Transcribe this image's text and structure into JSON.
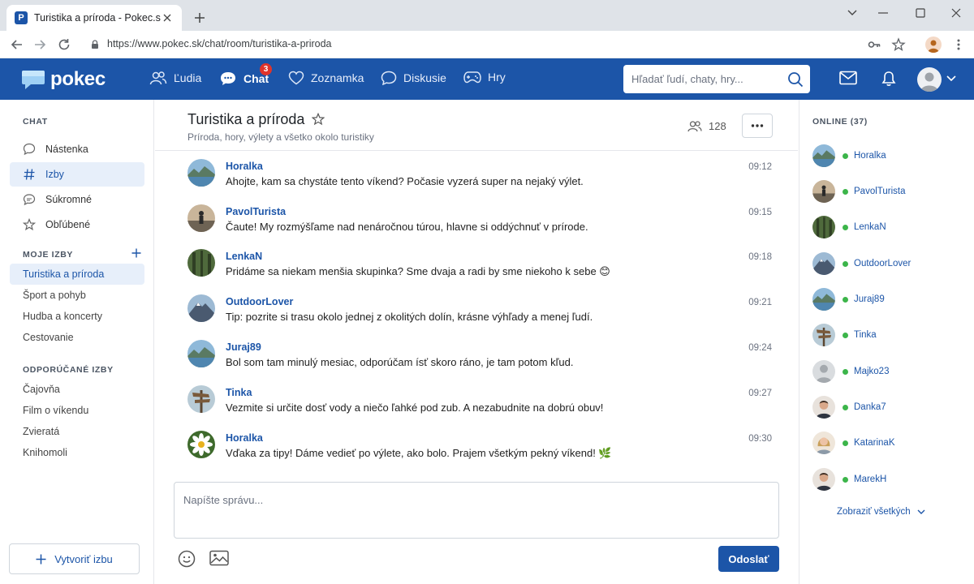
{
  "browser": {
    "tab_title": "Turistika a príroda - Pokec.sk",
    "favicon_letter": "P",
    "url": "https://www.pokec.sk/chat/room/turistika-a-priroda"
  },
  "header": {
    "logo": "pokec",
    "nav": [
      {
        "label": "Ľudia",
        "icon": "people-icon"
      },
      {
        "label": "Chat",
        "icon": "chat-icon",
        "badge": "3",
        "active": true
      },
      {
        "label": "Zoznamka",
        "icon": "heart-icon"
      },
      {
        "label": "Diskusie",
        "icon": "discussion-icon"
      },
      {
        "label": "Hry",
        "icon": "gamepad-icon"
      }
    ],
    "search_placeholder": "Hľadať ľudí, chaty, hry..."
  },
  "sidebar": {
    "chat_title": "CHAT",
    "items": [
      {
        "label": "Nástenka",
        "icon": "bubble-icon"
      },
      {
        "label": "Izby",
        "icon": "hash-icon",
        "active": true
      },
      {
        "label": "Súkromné",
        "icon": "private-chat-icon"
      },
      {
        "label": "Obľúbené",
        "icon": "star-icon"
      }
    ],
    "my_rooms_title": "MOJE IZBY",
    "my_rooms": [
      "Turistika a príroda",
      "Šport a pohyb",
      "Hudba a koncerty",
      "Cestovanie"
    ],
    "recommended_title": "ODPORÚČANÉ IZBY",
    "recommended": [
      "Čajovňa",
      "Film o víkendu",
      "Zvieratá",
      "Knihomoli"
    ],
    "create_label": "Vytvoriť izbu"
  },
  "room": {
    "title": "Turistika a príroda",
    "subtitle": "Príroda, hory, výlety a všetko okolo turistiky",
    "member_count": "128"
  },
  "messages": [
    {
      "user": "Horalka",
      "time": "09:12",
      "text": "Ahojte, kam sa chystáte tento víkend? Počasie vyzerá super na nejaký výlet.",
      "avatar": "lake-avatar"
    },
    {
      "user": "PavolTurista",
      "time": "09:15",
      "text": "Čaute! My rozmýšľame nad nenáročnou túrou, hlavne si oddýchnuť v prírode.",
      "avatar": "hiker-avatar"
    },
    {
      "user": "LenkaN",
      "time": "09:18",
      "text": "Pridáme sa niekam menšia skupinka? Sme dvaja a radi by sme niekoho k sebe 😊",
      "avatar": "forest-avatar"
    },
    {
      "user": "OutdoorLover",
      "time": "09:21",
      "text": "Tip: pozrite si trasu okolo jednej z okolitých dolín, krásne výhľady a menej ľudí.",
      "avatar": "mountain-avatar"
    },
    {
      "user": "Juraj89",
      "time": "09:24",
      "text": "Bol som tam minulý mesiac, odporúčam ísť skoro ráno, je tam potom kľud.",
      "avatar": "lake-avatar"
    },
    {
      "user": "Tinka",
      "time": "09:27",
      "text": "Vezmite si určite dosť vody a niečo ľahké pod zub. A nezabudnite na dobrú obuv!",
      "avatar": "signpost-avatar"
    },
    {
      "user": "Horalka",
      "time": "09:30",
      "text": "Vďaka za tipy! Dáme vedieť po výlete, ako bolo. Prajem všetkým pekný víkend! 🌿",
      "avatar": "daisy-avatar"
    }
  ],
  "composer": {
    "placeholder": "Napíšte správu...",
    "send_label": "Odoslať"
  },
  "online": {
    "title": "ONLINE (37)",
    "users": [
      {
        "name": "Horalka",
        "avatar": "lake-avatar"
      },
      {
        "name": "PavolTurista",
        "avatar": "hiker-avatar"
      },
      {
        "name": "LenkaN",
        "avatar": "forest-avatar"
      },
      {
        "name": "OutdoorLover",
        "avatar": "mountain-avatar"
      },
      {
        "name": "Juraj89",
        "avatar": "lake-avatar"
      },
      {
        "name": "Tinka",
        "avatar": "signpost-avatar"
      },
      {
        "name": "Majko23",
        "avatar": "default-avatar"
      },
      {
        "name": "Danka7",
        "avatar": "man-avatar"
      },
      {
        "name": "KatarinaK",
        "avatar": "woman-avatar"
      },
      {
        "name": "MarekH",
        "avatar": "man-avatar"
      }
    ],
    "show_all_label": "Zobraziť všetkých"
  },
  "colors": {
    "brand": "#1c55a8",
    "online": "#3cb54a",
    "badge": "#e0342b"
  }
}
